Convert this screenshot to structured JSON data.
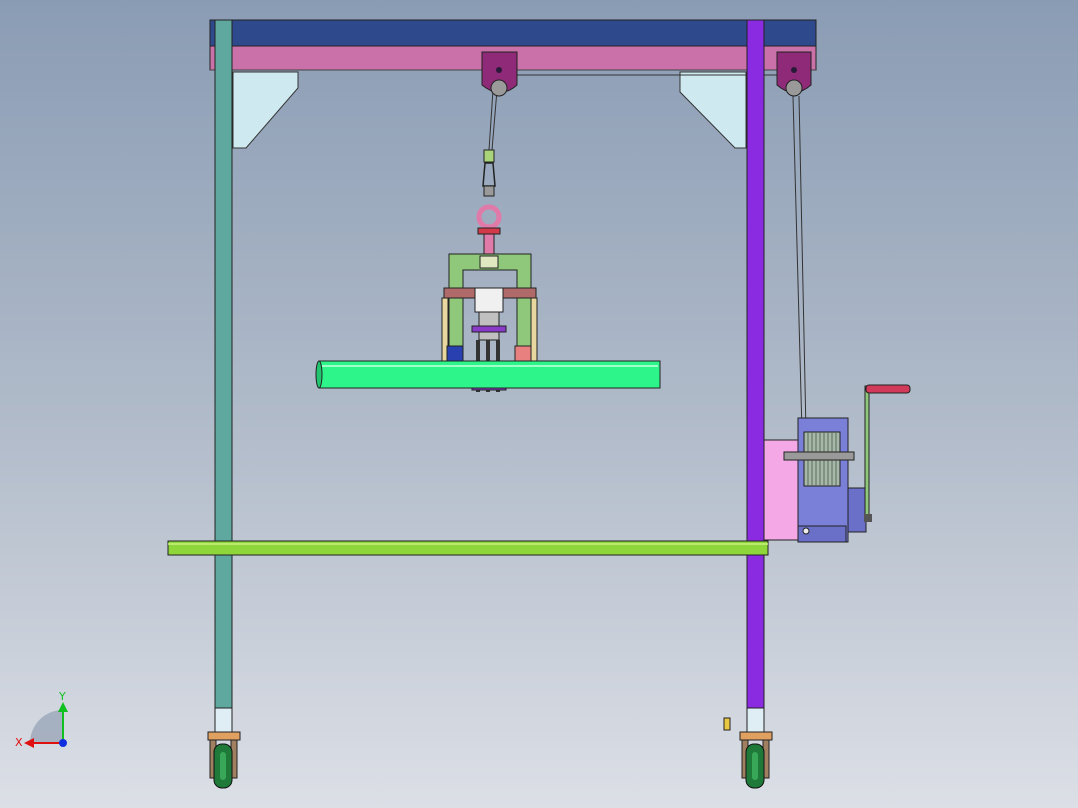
{
  "viewport": {
    "background_top": "#8a9cb4",
    "background_bottom": "#dcdfe6"
  },
  "model": {
    "frame": {
      "top_beam_color": "#2e4a8c",
      "sub_beam_color": "#c971a8",
      "left_post_color": "#5fa8a0",
      "right_post_color": "#8a2be2",
      "gusset_color": "#cfe9f0"
    },
    "hoist": {
      "pulley_color": "#8e2a78",
      "hook_color": "#e07aa8",
      "clamp_color": "#8fc87a",
      "cross_bar_color": "#b06a6a",
      "load_pipe_color": "#2ef58a"
    },
    "winch": {
      "plate_color": "#f4a8e6",
      "drum_color": "#7a80d8",
      "handle_color": "#d23a5a"
    },
    "cross_rail_color": "#8fd63a",
    "caster_wheel_color": "#1f7a3a"
  },
  "triad": {
    "x_label": "X",
    "y_label": "Y",
    "x_color": "#e01010",
    "y_color": "#10c020",
    "z_color": "#1030e0"
  }
}
